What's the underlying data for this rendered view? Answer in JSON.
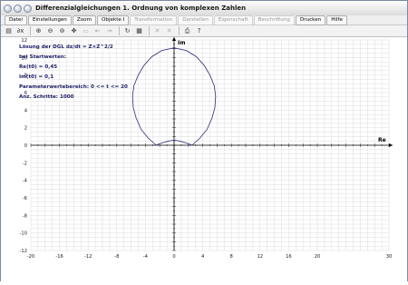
{
  "window": {
    "title": "Differenzialgleichungen 1. Ordnung von komplexen Zahlen"
  },
  "menu": [
    {
      "label": "Datei",
      "enabled": true
    },
    {
      "label": "Einstellungen",
      "enabled": true
    },
    {
      "label": "Zoom",
      "enabled": true
    },
    {
      "label": "Objekte I",
      "enabled": true
    },
    {
      "label": "Transformation",
      "enabled": false
    },
    {
      "label": "Darstellen",
      "enabled": false
    },
    {
      "label": "Eigenschaft",
      "enabled": false
    },
    {
      "label": "Beschriftung",
      "enabled": false
    },
    {
      "label": "Drucken",
      "enabled": true
    },
    {
      "label": "Hilfe",
      "enabled": true
    }
  ],
  "toolbar": [
    {
      "name": "notebook-icon",
      "glyph": "▤",
      "enabled": true
    },
    {
      "name": "function-dx-icon",
      "glyph": "∂x",
      "enabled": true
    },
    {
      "name": "zoom-in-icon",
      "glyph": "⊕",
      "enabled": true
    },
    {
      "name": "zoom-out-icon",
      "glyph": "⊖",
      "enabled": true
    },
    {
      "name": "zoom-fit-icon",
      "glyph": "⊚",
      "enabled": true
    },
    {
      "name": "pan-icon",
      "glyph": "✥",
      "enabled": true
    },
    {
      "name": "select-icon",
      "glyph": "▭",
      "enabled": false
    },
    {
      "name": "align-left-icon",
      "glyph": "⇤",
      "enabled": false
    },
    {
      "name": "align-right-icon",
      "glyph": "⇥",
      "enabled": false
    },
    {
      "name": "redo-icon",
      "glyph": "↻",
      "enabled": true
    },
    {
      "name": "clipboard-icon",
      "glyph": "▦",
      "enabled": true
    },
    {
      "name": "delete-icon",
      "glyph": "✕",
      "enabled": false
    },
    {
      "name": "delete-all-icon",
      "glyph": "✕",
      "enabled": false
    },
    {
      "name": "print-icon",
      "glyph": "⎙",
      "enabled": true
    },
    {
      "name": "help-icon",
      "glyph": "?",
      "enabled": true
    }
  ],
  "info": {
    "heading": "Lösung der DGL dz/dt = Z×Z^2/2",
    "startwerte": "bei Startwerten:",
    "re": "Re(t0) = 0,45",
    "im": "Im(t0) = 0,1",
    "param": "Parameterwertebereich: 0 <= t <= 20",
    "steps": "Anz. Schritte: 1000"
  },
  "colors": {
    "curve": "#2a2a7a",
    "grid": "#d3d3d3",
    "axis": "#000000",
    "info_text": "#1a1a66"
  },
  "chart_data": {
    "type": "line",
    "xlabel": "Re",
    "ylabel": "Im",
    "xlim": [
      -20,
      30
    ],
    "ylim": [
      -12,
      12
    ],
    "grid": true,
    "x_ticks": [
      -20,
      -16,
      -12,
      -8,
      -4,
      0,
      4,
      8,
      12,
      16,
      20,
      30
    ],
    "y_ticks": [
      -12,
      -10,
      -8,
      -6,
      -4,
      -2,
      0,
      2,
      4,
      6,
      8,
      10,
      12
    ],
    "series": [
      {
        "x": [
          -2.5,
          -2.3,
          -2.1,
          -1.9,
          -1.7,
          -1.4,
          -1.2,
          -1.0,
          -0.8,
          -0.6,
          -0.4,
          -0.2,
          0.0
        ],
        "y": [
          0.0,
          0.08,
          0.14,
          0.2,
          0.26,
          0.32,
          0.37,
          0.42,
          0.46,
          0.5,
          0.53,
          0.55,
          0.56
        ]
      },
      {
        "x": [
          0.0,
          0.2,
          0.4,
          0.6,
          0.8,
          1.0,
          1.2,
          1.4,
          1.7,
          1.9,
          2.1,
          2.3,
          2.5
        ],
        "y": [
          0.56,
          0.55,
          0.53,
          0.5,
          0.46,
          0.42,
          0.37,
          0.32,
          0.26,
          0.2,
          0.14,
          0.08,
          0.0
        ]
      },
      {
        "x": [
          -2.5,
          -3.6,
          -4.6,
          -5.3,
          -5.7,
          -5.8,
          -5.6,
          -5.0,
          -4.2,
          -3.1,
          -1.7,
          0.0,
          1.7,
          3.1,
          4.2,
          5.0,
          5.6,
          5.8,
          5.7,
          5.3,
          4.6,
          3.6,
          2.5
        ],
        "y": [
          0.0,
          0.8,
          1.8,
          3.1,
          4.3,
          5.6,
          6.8,
          8.0,
          9.1,
          10.1,
          10.8,
          11.1,
          10.8,
          10.1,
          9.1,
          8.0,
          6.8,
          5.6,
          4.3,
          3.1,
          1.8,
          0.8,
          0.0
        ]
      }
    ]
  }
}
